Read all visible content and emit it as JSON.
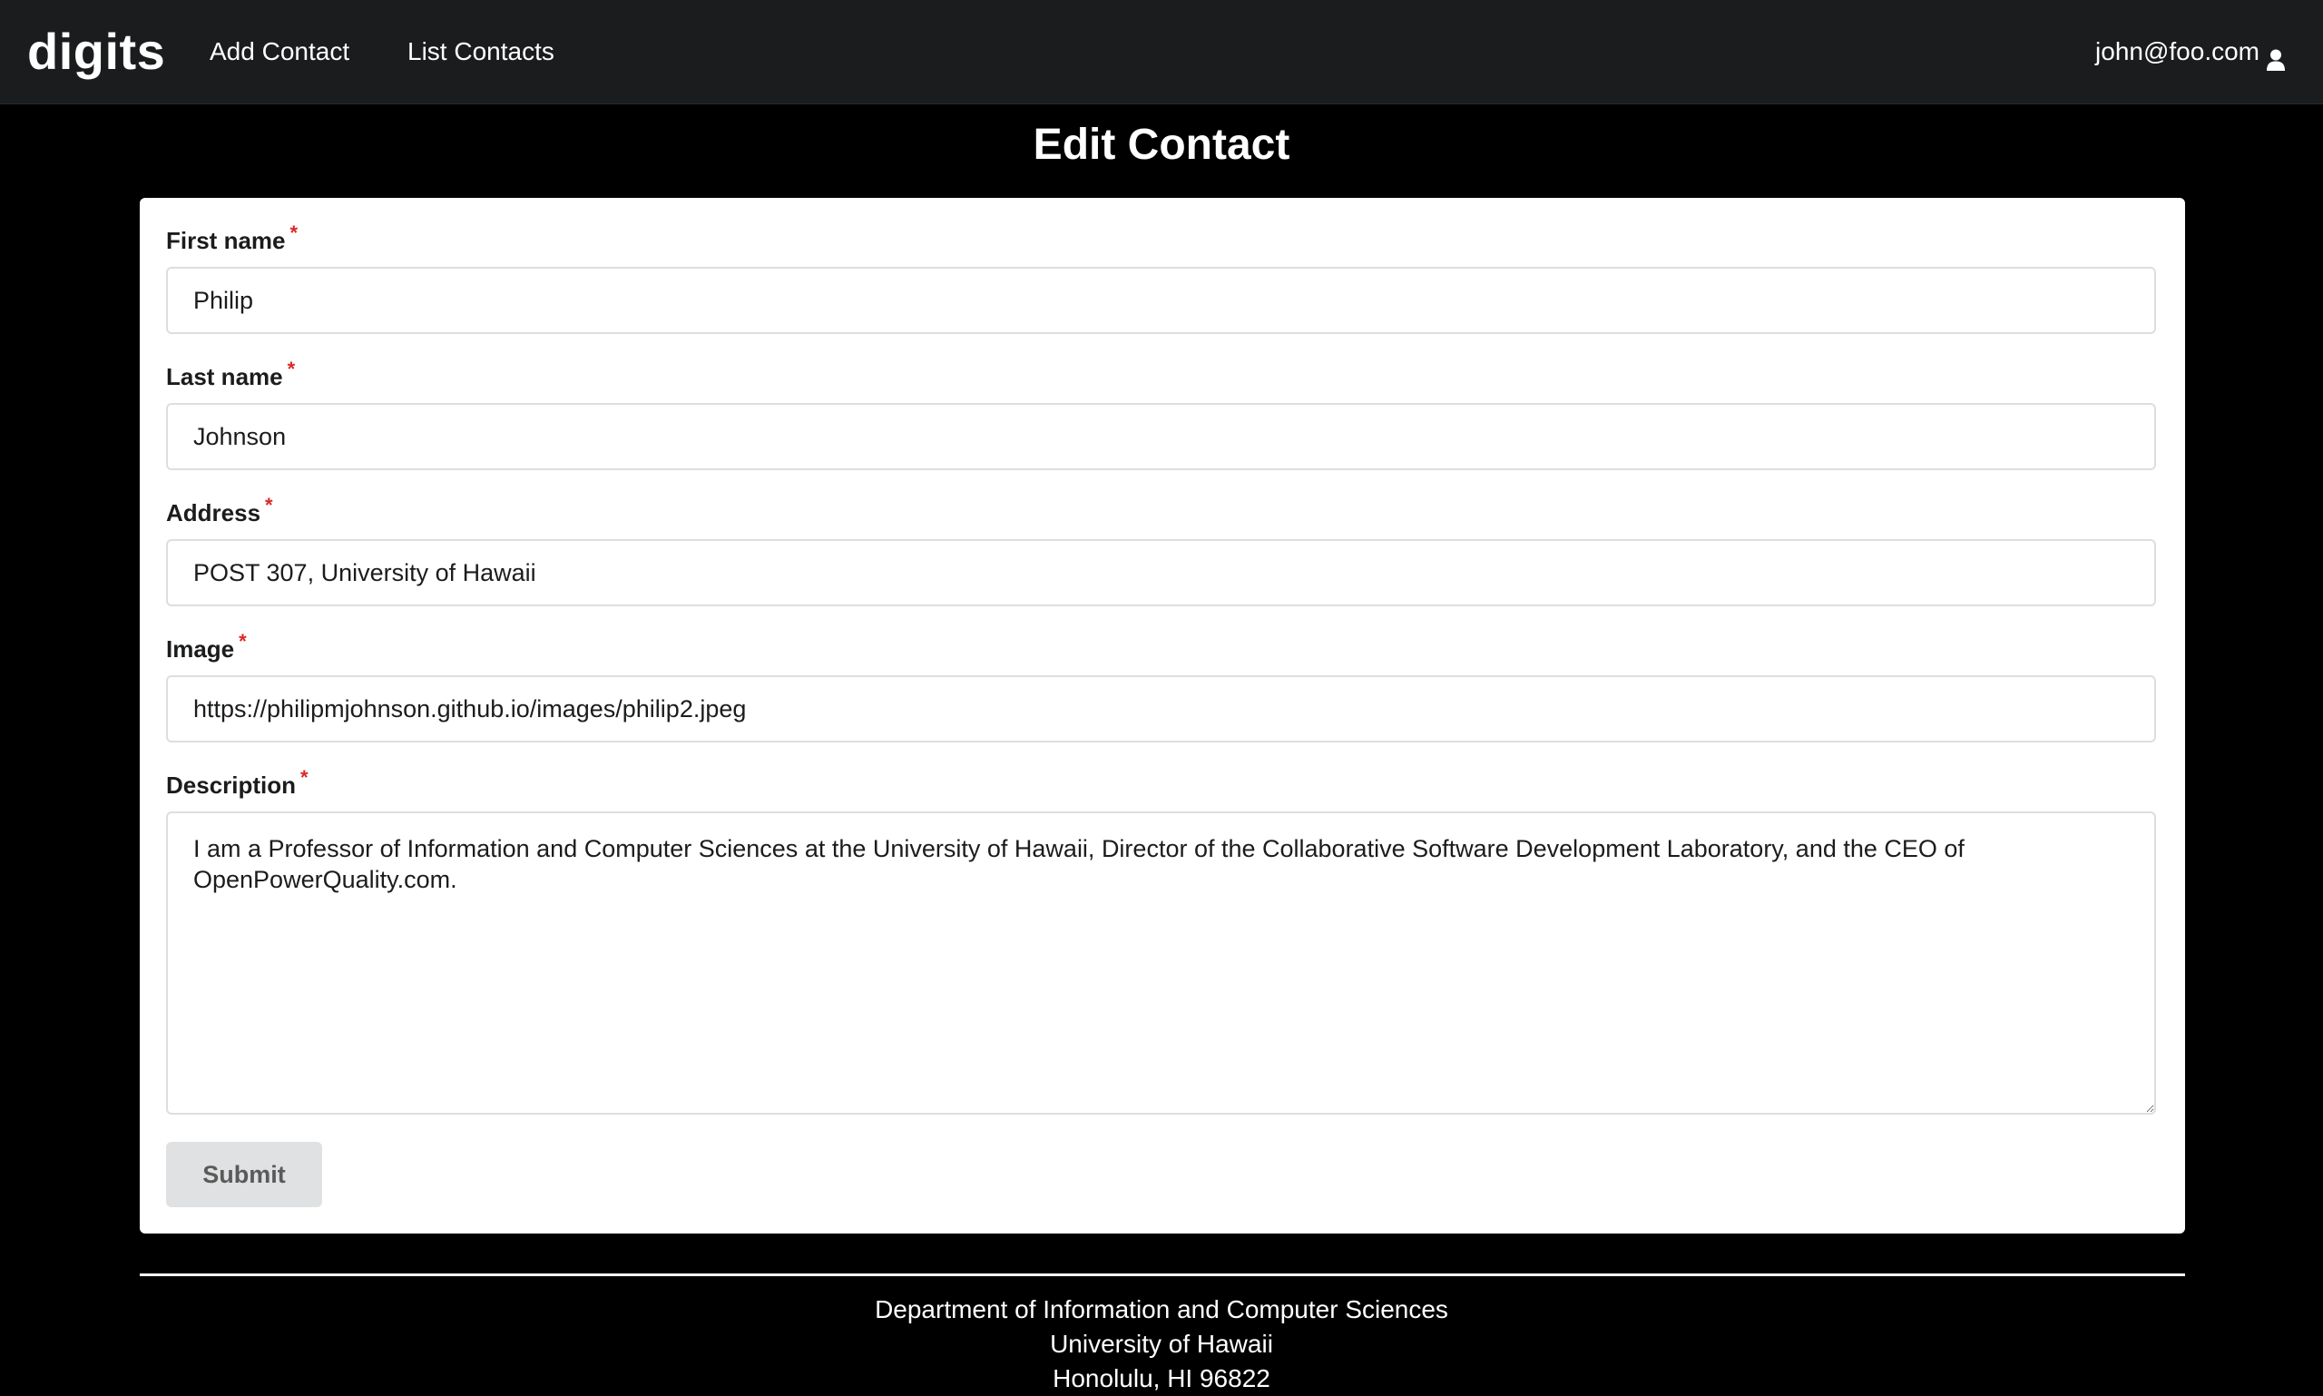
{
  "navbar": {
    "brand": "digits",
    "add_contact": "Add Contact",
    "list_contacts": "List Contacts",
    "user_email": "john@foo.com",
    "user_icon": "user-icon"
  },
  "page": {
    "title": "Edit Contact"
  },
  "form": {
    "required_marker": "*",
    "first_name": {
      "label": "First name",
      "value": "Philip"
    },
    "last_name": {
      "label": "Last name",
      "value": "Johnson"
    },
    "address": {
      "label": "Address",
      "value": "POST 307, University of Hawaii"
    },
    "image": {
      "label": "Image",
      "value": "https://philipmjohnson.github.io/images/philip2.jpeg"
    },
    "description": {
      "label": "Description",
      "value": "I am a Professor of Information and Computer Sciences at the University of Hawaii, Director of the Collaborative Software Development Laboratory, and the CEO of OpenPowerQuality.com."
    },
    "submit_label": "Submit"
  },
  "footer": {
    "line1": "Department of Information and Computer Sciences",
    "line2": "University of Hawaii",
    "line3": "Honolulu, HI 96822"
  },
  "colors": {
    "navbar_bg": "#1b1c1d",
    "page_bg": "#000000",
    "required_marker": "#db2828",
    "submit_bg": "#e0e1e2"
  }
}
